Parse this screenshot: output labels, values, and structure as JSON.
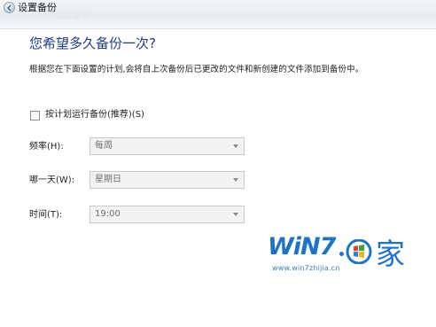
{
  "window": {
    "title": "设置备份",
    "ghost_title": "设置备份"
  },
  "main": {
    "heading": "您希望多久备份一次?",
    "description": "根据您在下面设置的计划,会将自上次备份后已更改的文件和新创建的文件添加到备份中。"
  },
  "schedule": {
    "checkbox_label": "按计划运行备份(推荐)(S)",
    "checked": false
  },
  "fields": {
    "frequency": {
      "label": "频率(H):",
      "value": "每周"
    },
    "day": {
      "label": "哪一天(W):",
      "value": "星期日"
    },
    "time": {
      "label": "时间(T):",
      "value": "19:00"
    }
  },
  "watermark": {
    "brand": "WiN7",
    "char": "家",
    "url": "www.win7zhijia.cn"
  },
  "colors": {
    "heading": "#1f3c88",
    "watermark": "#1f73c6"
  },
  "icons": {
    "back": "back-arrow-icon",
    "dropdown": "chevron-down-icon",
    "windows_logo": "windows-logo-icon"
  }
}
